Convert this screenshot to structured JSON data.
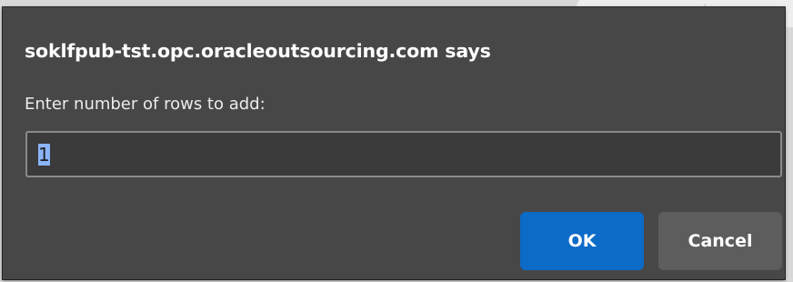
{
  "dialog": {
    "title": "soklfpub-tst.opc.oracleoutsourcing.com says",
    "message": "Enter number of rows to add:",
    "input_value": "1",
    "ok_label": "OK",
    "cancel_label": "Cancel"
  },
  "colors": {
    "dialog_background": "#474747",
    "ok_button": "#0b6bc7",
    "cancel_button": "#5d5d5d",
    "selection_highlight": "#8ab4f8"
  }
}
